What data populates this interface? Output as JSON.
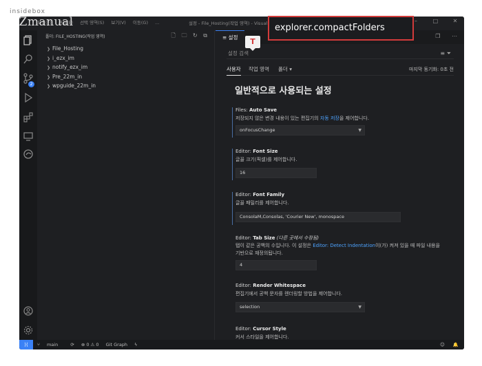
{
  "watermark": {
    "top": "insidebox",
    "brand": "CZmanual"
  },
  "callout": "explorer.compactFolders",
  "marker": "T",
  "titlebar": {
    "menus": [
      "파일(F)",
      "편집(E)",
      "선택 영역(S)",
      "보기(V)",
      "이동(G)",
      "..."
    ],
    "title": "설정 - File_Hosting(작업 영역) - Visual Studio Code"
  },
  "activity_icons": [
    "explorer-icon",
    "search-icon",
    "source-control-icon",
    "run-debug-icon",
    "extensions-icon",
    "remote-explorer-icon",
    "edge-icon",
    "account-icon",
    "manage-gear-icon"
  ],
  "source_control_badge": "2",
  "sidebar": {
    "header": "폴더: FILE_HOSTING(작업 영역)",
    "items": [
      "File_Hosting",
      "i_ezx_im",
      "notify_ezx_im",
      "Pre_22m_in",
      "wpguide_22m_in"
    ]
  },
  "editor": {
    "tab_label": "설정",
    "search_placeholder": "설정 검색",
    "scopes": {
      "user": "사용자",
      "workspace": "작업 영역",
      "folder": "폴더"
    },
    "sync": "마지막 동기화: 0초 전",
    "heading": "일반적으로 사용되는 설정"
  },
  "settings": [
    {
      "category": "Files: ",
      "name": "Auto Save",
      "desc_before": "저장되지 않은 변경 내용이 있는 편집기의 ",
      "desc_link": "자동 저장",
      "desc_after": "을 제어합니다.",
      "value": "onFocusChange"
    },
    {
      "category": "Editor: ",
      "name": "Font Size",
      "desc": "글꼴 크기(픽셀)를 제어합니다.",
      "value": "16"
    },
    {
      "category": "Editor: ",
      "name": "Font Family",
      "desc": "글꼴 패밀리를 제어합니다.",
      "value": "ConsolaM,Consolas, 'Courier New', monospace"
    },
    {
      "category": "Editor: ",
      "name": "Tab Size",
      "modified": "(다른 곳에서 수정됨)",
      "desc_before": "탭이 같은 공백의 수입니다. 이 설정은 ",
      "desc_link": "Editor: Detect Indentation",
      "desc_after": "이(가) 켜져 있을 때 파일 내용을 기반으로 재정의됩니다.",
      "value": "4"
    },
    {
      "category": "Editor: ",
      "name": "Render Whitespace",
      "desc": "편집기에서 공백 문자를 렌더링할 방법을 제어합니다.",
      "value": "selection"
    },
    {
      "category": "Editor: ",
      "name": "Cursor Style",
      "desc": "커서 스타일을 제어합니다."
    }
  ],
  "statusbar": {
    "branch": "main",
    "problems": "⊗ 0 ⚠ 0",
    "git_graph": "Git Graph"
  }
}
